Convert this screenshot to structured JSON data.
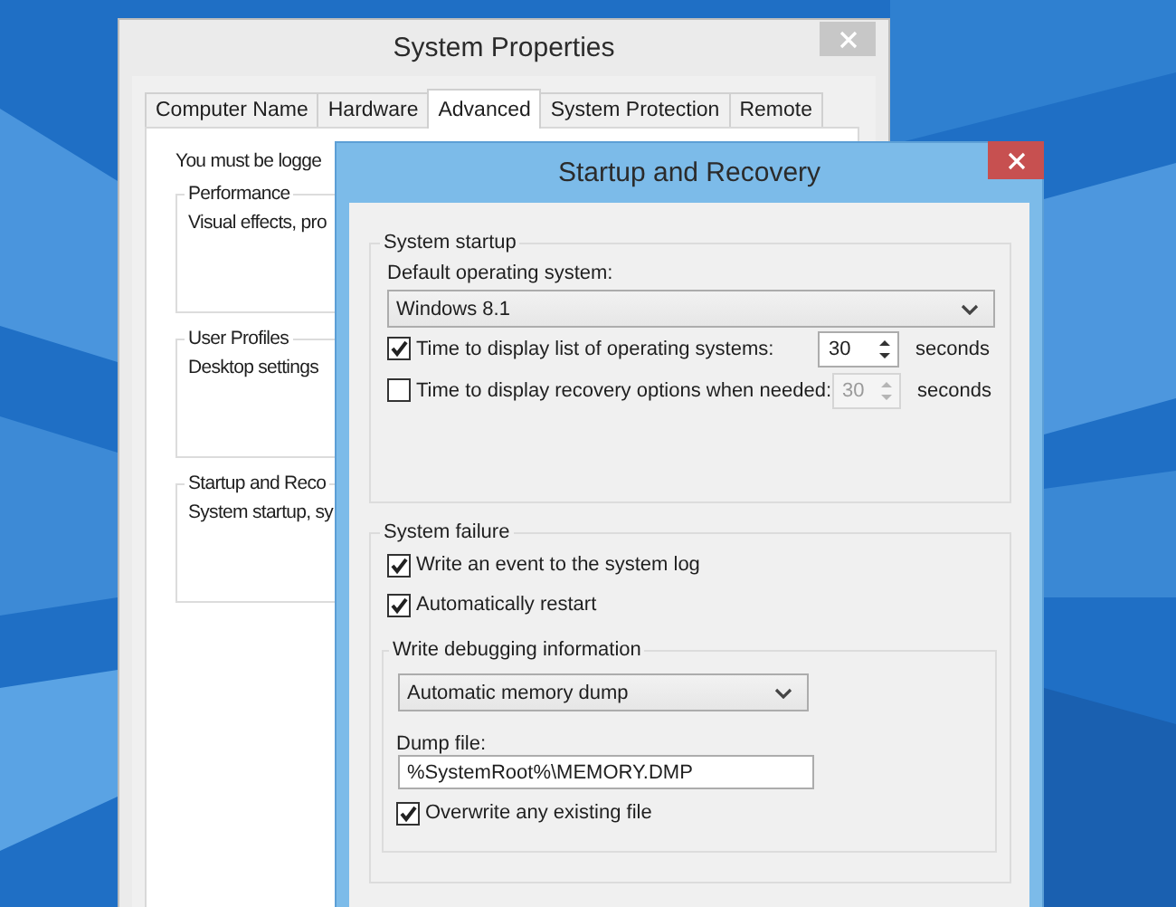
{
  "back_window": {
    "title": "System Properties",
    "tabs": [
      {
        "label": "Computer Name",
        "selected": false
      },
      {
        "label": "Hardware",
        "selected": false
      },
      {
        "label": "Advanced",
        "selected": true
      },
      {
        "label": "System Protection",
        "selected": false
      },
      {
        "label": "Remote",
        "selected": false
      }
    ],
    "intro": "You must be logge",
    "groups": [
      {
        "title": "Performance",
        "text": "Visual effects, pro"
      },
      {
        "title": "User Profiles",
        "text": "Desktop settings"
      },
      {
        "title": "Startup and Reco",
        "text": "System startup, sy"
      }
    ]
  },
  "front_window": {
    "title": "Startup and Recovery",
    "startup": {
      "title": "System startup",
      "default_os_label": "Default operating system:",
      "default_os": "Windows 8.1",
      "rows": [
        {
          "label": "Time to display list of operating systems:",
          "checked": true,
          "value": "30",
          "disabled": false,
          "unit": "seconds"
        },
        {
          "label": "Time to display recovery options when needed:",
          "checked": false,
          "value": "30",
          "disabled": true,
          "unit": "seconds"
        }
      ]
    },
    "failure": {
      "title": "System failure",
      "checks": [
        {
          "label": "Write an event to the system log",
          "checked": true
        },
        {
          "label": "Automatically restart",
          "checked": true
        }
      ],
      "debug": {
        "title": "Write debugging information",
        "dump_type": "Automatic memory dump",
        "dump_file_label": "Dump file:",
        "dump_file": "%SystemRoot%\\MEMORY.DMP",
        "overwrite": {
          "label": "Overwrite any existing file",
          "checked": true
        }
      }
    }
  }
}
